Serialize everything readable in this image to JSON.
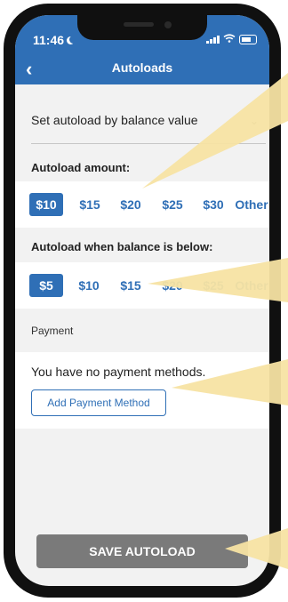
{
  "status_bar": {
    "time": "11:46"
  },
  "header": {
    "back_icon": "chevron-left-icon",
    "title": "Autoloads"
  },
  "mode_select": {
    "value": "Set autoload by balance value",
    "icon": "chevron-down-icon"
  },
  "autoload_amount": {
    "title": "Autoload amount:",
    "options": [
      "$10",
      "$15",
      "$20",
      "$25",
      "$30",
      "Other"
    ],
    "selected": "$10"
  },
  "threshold": {
    "title": "Autoload when balance is below:",
    "options": [
      "$5",
      "$10",
      "$15",
      "$20",
      "$25",
      "Other"
    ],
    "selected": "$5"
  },
  "payment": {
    "label": "Payment",
    "message": "You have no payment methods.",
    "add_button": "Add Payment Method"
  },
  "save_button": "SAVE AUTOLOAD",
  "colors": {
    "primary": "#2f6fb6",
    "save_disabled": "#7a7a7a",
    "callout": "#f7e3a3"
  }
}
